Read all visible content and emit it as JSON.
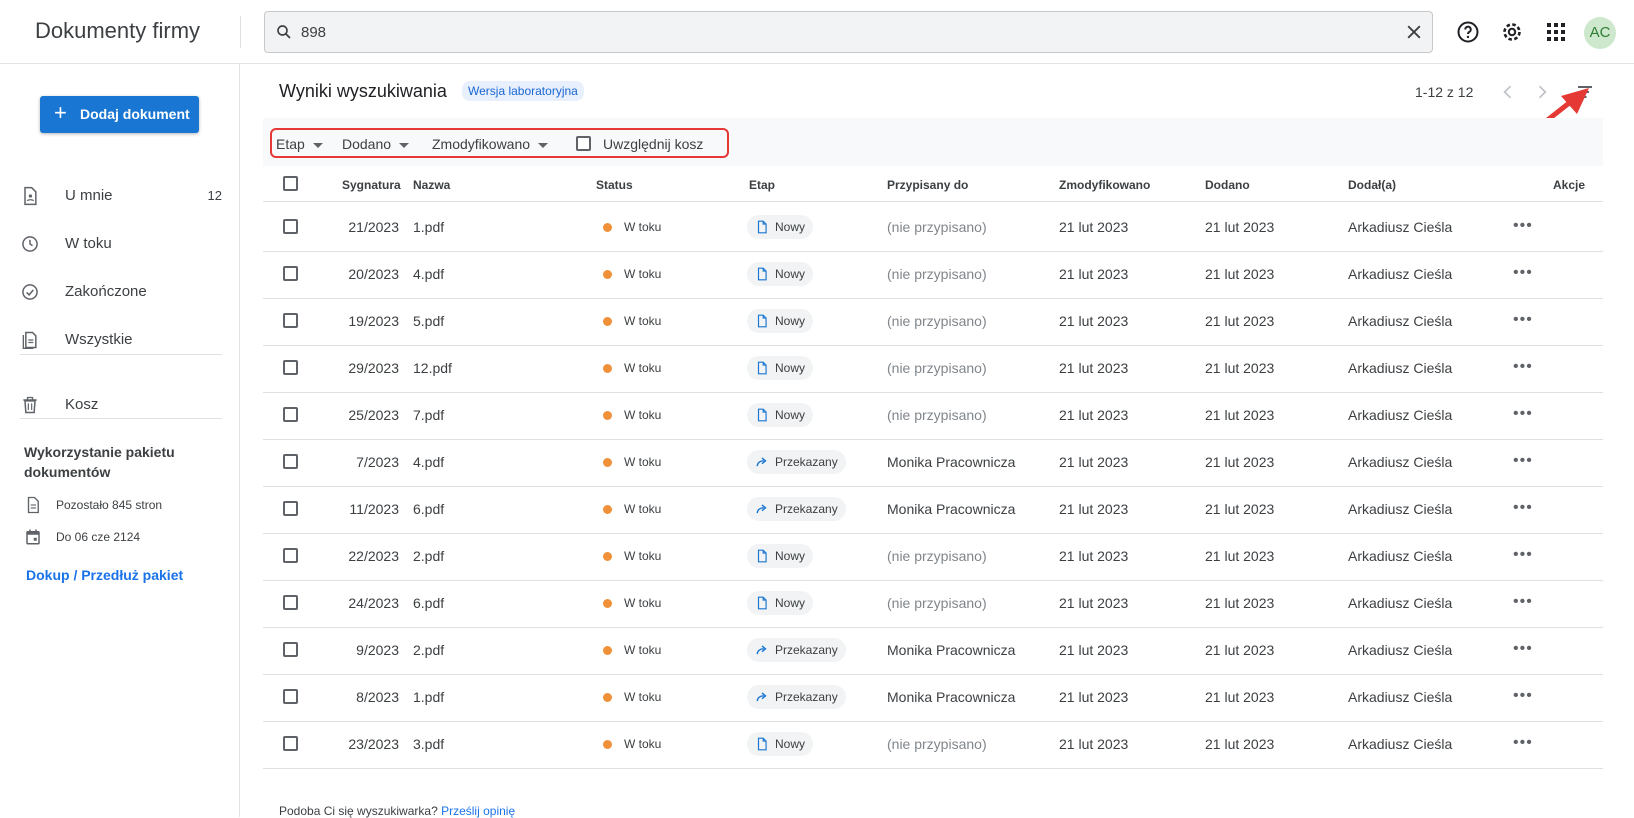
{
  "app": {
    "title": "Dokumenty firmy"
  },
  "search": {
    "value": "898"
  },
  "user": {
    "initials": "AC"
  },
  "sidebar": {
    "add_button": "Dodaj dokument",
    "items": [
      {
        "label": "U mnie",
        "count": "12"
      },
      {
        "label": "W toku",
        "count": ""
      },
      {
        "label": "Zakończone",
        "count": ""
      },
      {
        "label": "Wszystkie",
        "count": ""
      },
      {
        "label": "Kosz",
        "count": ""
      }
    ],
    "usage": {
      "title": "Wykorzystanie pakietu dokumentów",
      "pages_left": "Pozostało 845 stron",
      "valid_until": "Do 06 cze 2124",
      "buy_link": "Dokup / Przedłuż pakiet"
    }
  },
  "main": {
    "title": "Wyniki wyszukiwania",
    "badge": "Wersja laboratoryjna",
    "pagination": "1-12 z 12",
    "filters": {
      "etap": "Etap",
      "dodano": "Dodano",
      "zmodyfikowano": "Zmodyfikowano",
      "kosz": "Uwzględnij kosz"
    },
    "columns": {
      "sygnatura": "Sygnatura",
      "nazwa": "Nazwa",
      "status": "Status",
      "etap": "Etap",
      "przypisany": "Przypisany do",
      "zmodyfikowano": "Zmodyfikowano",
      "dodano": "Dodano",
      "dodal": "Dodał(a)",
      "akcje": "Akcje"
    },
    "rows": [
      {
        "sig": "21/2023",
        "name": "1.pdf",
        "status": "W toku",
        "stage": "Nowy",
        "assignee": "(nie przypisano)",
        "modified": "21 lut 2023",
        "added": "21 lut 2023",
        "author": "Arkadiusz Cieśla"
      },
      {
        "sig": "20/2023",
        "name": "4.pdf",
        "status": "W toku",
        "stage": "Nowy",
        "assignee": "(nie przypisano)",
        "modified": "21 lut 2023",
        "added": "21 lut 2023",
        "author": "Arkadiusz Cieśla"
      },
      {
        "sig": "19/2023",
        "name": "5.pdf",
        "status": "W toku",
        "stage": "Nowy",
        "assignee": "(nie przypisano)",
        "modified": "21 lut 2023",
        "added": "21 lut 2023",
        "author": "Arkadiusz Cieśla"
      },
      {
        "sig": "29/2023",
        "name": "12.pdf",
        "status": "W toku",
        "stage": "Nowy",
        "assignee": "(nie przypisano)",
        "modified": "21 lut 2023",
        "added": "21 lut 2023",
        "author": "Arkadiusz Cieśla"
      },
      {
        "sig": "25/2023",
        "name": "7.pdf",
        "status": "W toku",
        "stage": "Nowy",
        "assignee": "(nie przypisano)",
        "modified": "21 lut 2023",
        "added": "21 lut 2023",
        "author": "Arkadiusz Cieśla"
      },
      {
        "sig": "7/2023",
        "name": "4.pdf",
        "status": "W toku",
        "stage": "Przekazany",
        "assignee": "Monika Pracownicza",
        "modified": "21 lut 2023",
        "added": "21 lut 2023",
        "author": "Arkadiusz Cieśla"
      },
      {
        "sig": "11/2023",
        "name": "6.pdf",
        "status": "W toku",
        "stage": "Przekazany",
        "assignee": "Monika Pracownicza",
        "modified": "21 lut 2023",
        "added": "21 lut 2023",
        "author": "Arkadiusz Cieśla"
      },
      {
        "sig": "22/2023",
        "name": "2.pdf",
        "status": "W toku",
        "stage": "Nowy",
        "assignee": "(nie przypisano)",
        "modified": "21 lut 2023",
        "added": "21 lut 2023",
        "author": "Arkadiusz Cieśla"
      },
      {
        "sig": "24/2023",
        "name": "6.pdf",
        "status": "W toku",
        "stage": "Nowy",
        "assignee": "(nie przypisano)",
        "modified": "21 lut 2023",
        "added": "21 lut 2023",
        "author": "Arkadiusz Cieśla"
      },
      {
        "sig": "9/2023",
        "name": "2.pdf",
        "status": "W toku",
        "stage": "Przekazany",
        "assignee": "Monika Pracownicza",
        "modified": "21 lut 2023",
        "added": "21 lut 2023",
        "author": "Arkadiusz Cieśla"
      },
      {
        "sig": "8/2023",
        "name": "1.pdf",
        "status": "W toku",
        "stage": "Przekazany",
        "assignee": "Monika Pracownicza",
        "modified": "21 lut 2023",
        "added": "21 lut 2023",
        "author": "Arkadiusz Cieśla"
      },
      {
        "sig": "23/2023",
        "name": "3.pdf",
        "status": "W toku",
        "stage": "Nowy",
        "assignee": "(nie przypisano)",
        "modified": "21 lut 2023",
        "added": "21 lut 2023",
        "author": "Arkadiusz Cieśla"
      }
    ],
    "footer_text": "Podoba Ci się wyszukiwarka?",
    "footer_link": "Prześlij opinię"
  },
  "colors": {
    "accent": "#1976d2",
    "status_in_progress": "#f0913a",
    "highlight": "#e53935"
  },
  "icons": [
    "search-icon",
    "close-icon",
    "help-icon",
    "gear-icon",
    "apps-icon",
    "filter-icon",
    "document-icon",
    "forward-icon",
    "more-icon",
    "trash-icon",
    "clock-icon",
    "check-circle-icon",
    "calendar-icon"
  ]
}
